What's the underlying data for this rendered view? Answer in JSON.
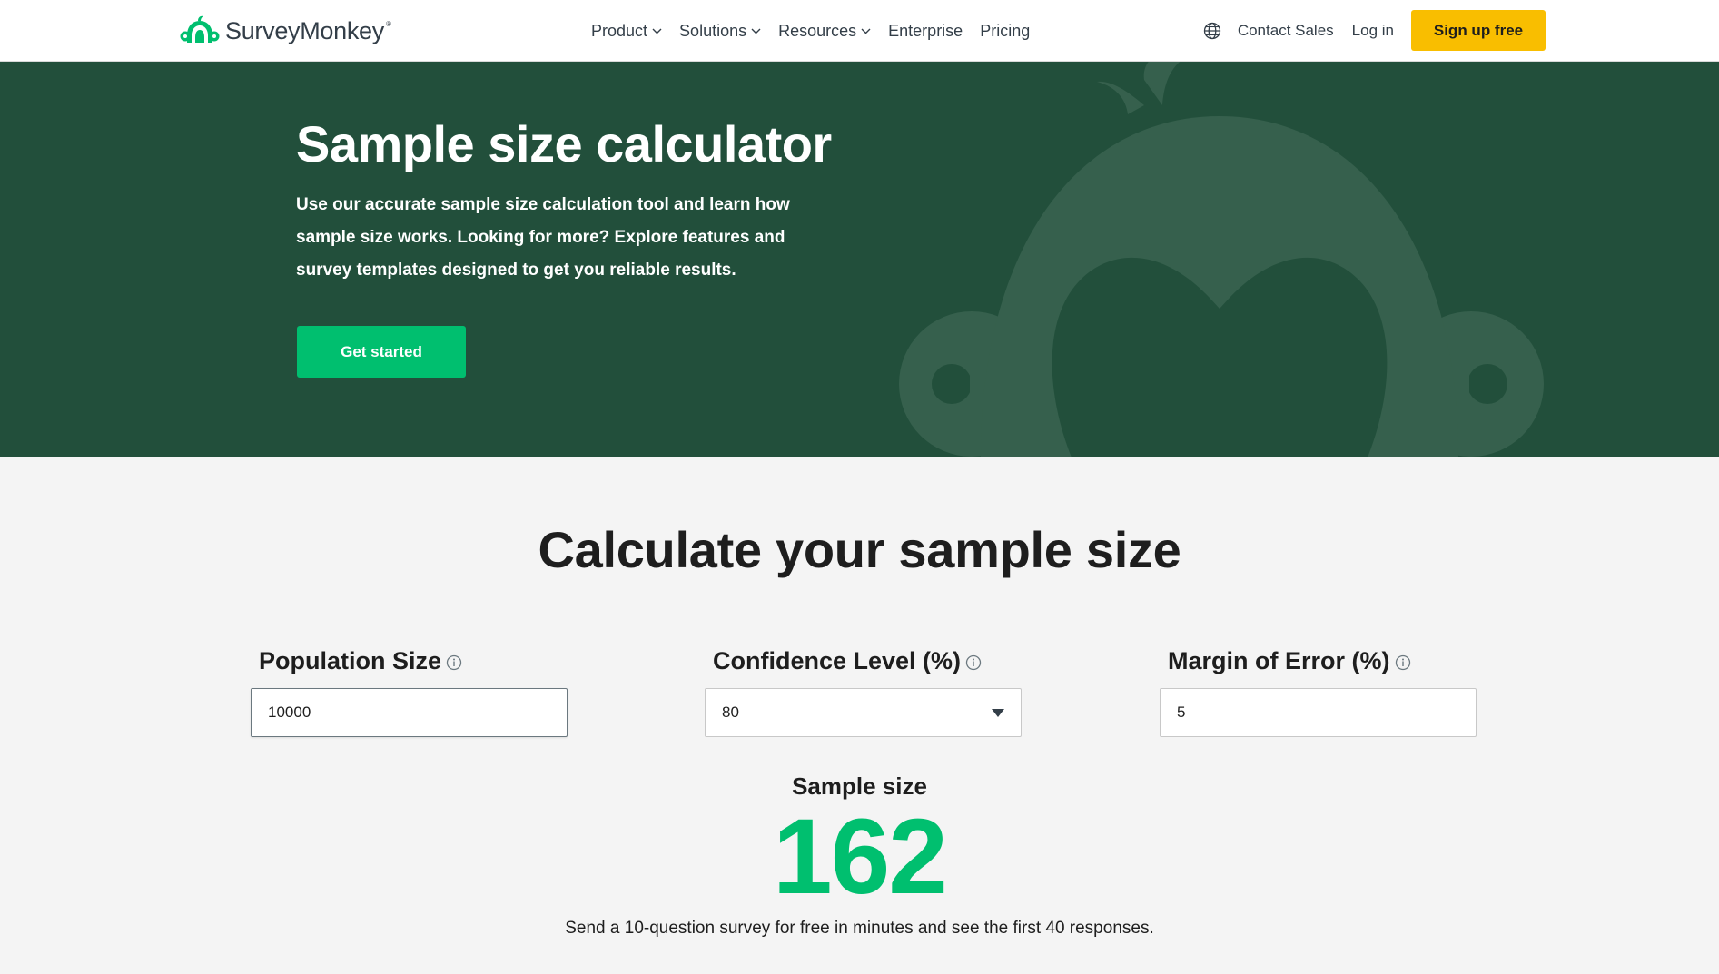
{
  "header": {
    "logo_text": "SurveyMonkey",
    "logo_reg": "®",
    "nav": [
      {
        "label": "Product",
        "has_dropdown": true
      },
      {
        "label": "Solutions",
        "has_dropdown": true
      },
      {
        "label": "Resources",
        "has_dropdown": true
      },
      {
        "label": "Enterprise",
        "has_dropdown": false
      },
      {
        "label": "Pricing",
        "has_dropdown": false
      }
    ],
    "language_icon": "globe-icon",
    "contact_sales": "Contact Sales",
    "log_in": "Log in",
    "sign_up": "Sign up free"
  },
  "hero": {
    "title": "Sample size calculator",
    "description": "Use our accurate sample size calculation tool and learn how sample size works. Looking for more? Explore features and survey templates designed to get you reliable results.",
    "cta": "Get started"
  },
  "calculator": {
    "title": "Calculate your sample size",
    "fields": [
      {
        "label": "Population Size",
        "value": "10000",
        "type": "text",
        "info_icon": "info-icon"
      },
      {
        "label": "Confidence Level (%)",
        "value": "80",
        "type": "select",
        "info_icon": "info-icon"
      },
      {
        "label": "Margin of Error (%)",
        "value": "5",
        "type": "text",
        "info_icon": "info-icon"
      }
    ],
    "result_label": "Sample size",
    "result_value": "162",
    "note": "Send a 10-question survey for free in minutes and see the first 40 responses."
  },
  "colors": {
    "brand_green": "#00bf6f",
    "hero_bg": "#224f3b",
    "signup_yellow": "#f9be00",
    "logo_green": "#00bf6f"
  }
}
